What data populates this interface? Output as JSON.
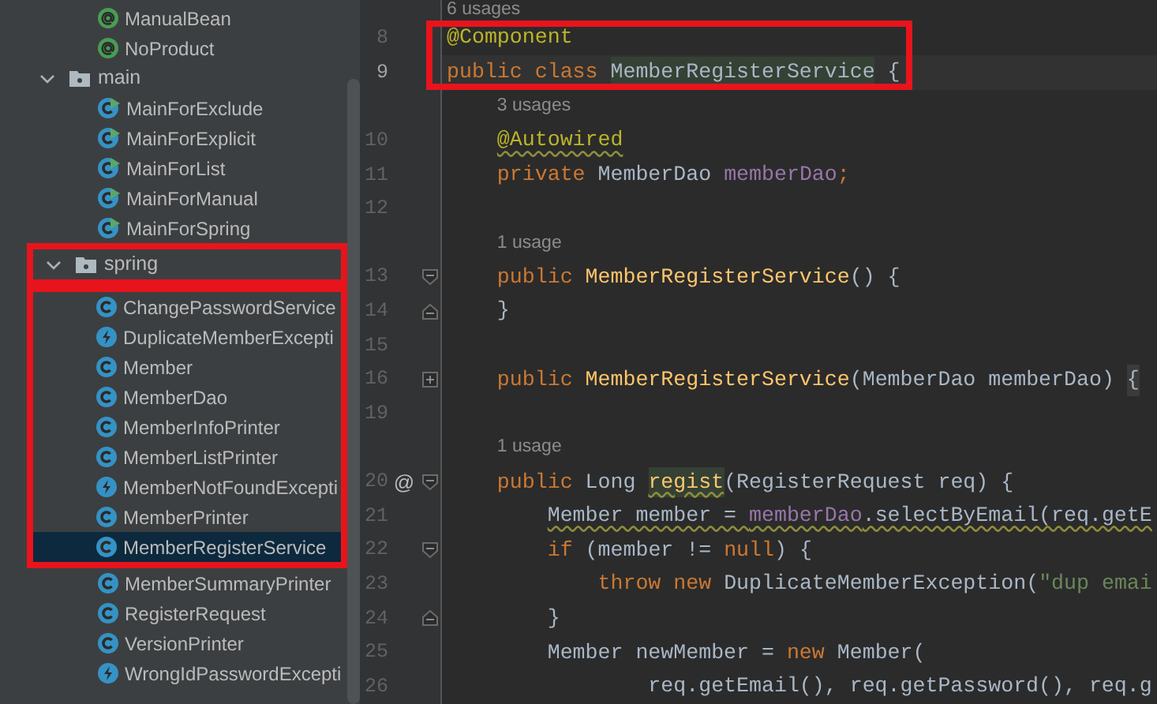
{
  "project_tree": {
    "leading_items": [
      {
        "name": "ManualBean",
        "kind": "annotation",
        "selected": false
      },
      {
        "name": "NoProduct",
        "kind": "annotation",
        "selected": false
      }
    ],
    "folders": [
      {
        "name": "main",
        "expanded": true,
        "highlighted": false,
        "children": [
          {
            "name": "MainForExclude",
            "kind": "runnable",
            "selected": false,
            "highlighted": false
          },
          {
            "name": "MainForExplicit",
            "kind": "runnable",
            "selected": false,
            "highlighted": false
          },
          {
            "name": "MainForList",
            "kind": "runnable",
            "selected": false,
            "highlighted": false
          },
          {
            "name": "MainForManual",
            "kind": "runnable",
            "selected": false,
            "highlighted": false
          },
          {
            "name": "MainForSpring",
            "kind": "runnable",
            "selected": false,
            "highlighted": false
          }
        ]
      },
      {
        "name": "spring",
        "expanded": true,
        "highlighted": true,
        "children": [
          {
            "name": "ChangePasswordService",
            "kind": "class",
            "selected": false,
            "highlighted": true
          },
          {
            "name": "DuplicateMemberExcepti",
            "kind": "exception",
            "selected": false,
            "highlighted": true
          },
          {
            "name": "Member",
            "kind": "class",
            "selected": false,
            "highlighted": true
          },
          {
            "name": "MemberDao",
            "kind": "class",
            "selected": false,
            "highlighted": true
          },
          {
            "name": "MemberInfoPrinter",
            "kind": "class",
            "selected": false,
            "highlighted": true
          },
          {
            "name": "MemberListPrinter",
            "kind": "class",
            "selected": false,
            "highlighted": true
          },
          {
            "name": "MemberNotFoundExcepti",
            "kind": "exception",
            "selected": false,
            "highlighted": true
          },
          {
            "name": "MemberPrinter",
            "kind": "class",
            "selected": false,
            "highlighted": true
          },
          {
            "name": "MemberRegisterService",
            "kind": "class",
            "selected": true,
            "highlighted": true
          },
          {
            "name": "MemberSummaryPrinter",
            "kind": "class",
            "selected": false,
            "highlighted": false
          },
          {
            "name": "RegisterRequest",
            "kind": "class",
            "selected": false,
            "highlighted": false
          },
          {
            "name": "VersionPrinter",
            "kind": "class",
            "selected": false,
            "highlighted": false
          },
          {
            "name": "WrongIdPasswordExcepti",
            "kind": "exception",
            "selected": false,
            "highlighted": false
          }
        ]
      }
    ]
  },
  "editor": {
    "lines": [
      {
        "kind": "usage",
        "text": "6 usages"
      },
      {
        "kind": "code",
        "number": "8",
        "current": false,
        "highlighted": true,
        "tokens": [
          {
            "text": "@Component",
            "kind": "annotation"
          }
        ]
      },
      {
        "kind": "code",
        "number": "9",
        "current": true,
        "highlighted": true,
        "tokens": [
          {
            "text": "public class ",
            "kind": "keyword"
          },
          {
            "text": "MemberRegisterService",
            "kind": "type",
            "highlighted": true
          },
          {
            "text": " {",
            "kind": "plain"
          }
        ]
      },
      {
        "kind": "usage",
        "text": "3 usages"
      },
      {
        "kind": "code",
        "number": "10",
        "current": false,
        "tokens": [
          {
            "text": "    @Autowired",
            "kind": "annotation",
            "warning": true
          }
        ]
      },
      {
        "kind": "code",
        "number": "11",
        "current": false,
        "tokens": [
          {
            "text": "    private ",
            "kind": "keyword"
          },
          {
            "text": "MemberDao ",
            "kind": "type"
          },
          {
            "text": "memberDao",
            "kind": "field"
          },
          {
            "text": ";",
            "kind": "keyword"
          }
        ]
      },
      {
        "kind": "code",
        "number": "12",
        "current": false
      },
      {
        "kind": "usage",
        "text": "1 usage"
      },
      {
        "kind": "code",
        "number": "13",
        "current": false,
        "fold": {
          "kind": "open"
        },
        "tokens": [
          {
            "text": "    public ",
            "kind": "keyword"
          },
          {
            "text": "MemberRegisterService",
            "kind": "method"
          },
          {
            "text": "() {",
            "kind": "plain"
          }
        ]
      },
      {
        "kind": "code",
        "number": "14",
        "current": false,
        "fold": {
          "kind": "close"
        },
        "tokens": [
          {
            "text": "    }",
            "kind": "plain"
          }
        ]
      },
      {
        "kind": "code",
        "number": "15",
        "current": false
      },
      {
        "kind": "code",
        "number": "16",
        "current": false,
        "fold": {
          "kind": "collapsed"
        },
        "tokens": [
          {
            "text": "    public ",
            "kind": "keyword"
          },
          {
            "text": "MemberRegisterService",
            "kind": "method"
          },
          {
            "text": "(MemberDao memberDao) ",
            "kind": "plain"
          },
          {
            "text": "{",
            "kind": "folded"
          }
        ]
      },
      {
        "kind": "code",
        "number": "19",
        "current": false
      },
      {
        "kind": "usage",
        "text": "1 usage"
      },
      {
        "kind": "code",
        "number": "20",
        "current": false,
        "marker": "@",
        "fold": {
          "kind": "open"
        },
        "tokens": [
          {
            "text": "    public ",
            "kind": "keyword"
          },
          {
            "text": "Long ",
            "kind": "type"
          },
          {
            "text": "regist",
            "kind": "method",
            "highlighted": true,
            "warning": true
          },
          {
            "text": "(RegisterRequest req) {",
            "kind": "plain"
          }
        ]
      },
      {
        "kind": "code",
        "number": "21",
        "current": false,
        "tokens": [
          {
            "text": "        Member member = ",
            "kind": "plain",
            "warning": true
          },
          {
            "text": "memberDao",
            "kind": "field",
            "warning": true
          },
          {
            "text": ".selectByEmail(req.getE",
            "kind": "plain",
            "warning": true
          }
        ]
      },
      {
        "kind": "code",
        "number": "22",
        "current": false,
        "fold": {
          "kind": "open"
        },
        "tokens": [
          {
            "text": "        if ",
            "kind": "keyword"
          },
          {
            "text": "(member != ",
            "kind": "plain"
          },
          {
            "text": "null",
            "kind": "keyword"
          },
          {
            "text": ") {",
            "kind": "plain"
          }
        ]
      },
      {
        "kind": "code",
        "number": "23",
        "current": false,
        "tokens": [
          {
            "text": "            throw new ",
            "kind": "keyword"
          },
          {
            "text": "DuplicateMemberException(",
            "kind": "plain"
          },
          {
            "text": "\"dup emai",
            "kind": "string"
          }
        ]
      },
      {
        "kind": "code",
        "number": "24",
        "current": false,
        "fold": {
          "kind": "close"
        },
        "tokens": [
          {
            "text": "        }",
            "kind": "plain"
          }
        ]
      },
      {
        "kind": "code",
        "number": "25",
        "current": false,
        "tokens": [
          {
            "text": "        Member newMember = ",
            "kind": "plain"
          },
          {
            "text": "new ",
            "kind": "keyword"
          },
          {
            "text": "Member(",
            "kind": "plain"
          }
        ]
      },
      {
        "kind": "code",
        "number": "26",
        "current": false,
        "tokens": [
          {
            "text": "                req.getEmail(), req.getPassword(), req.g",
            "kind": "plain"
          }
        ]
      }
    ]
  }
}
